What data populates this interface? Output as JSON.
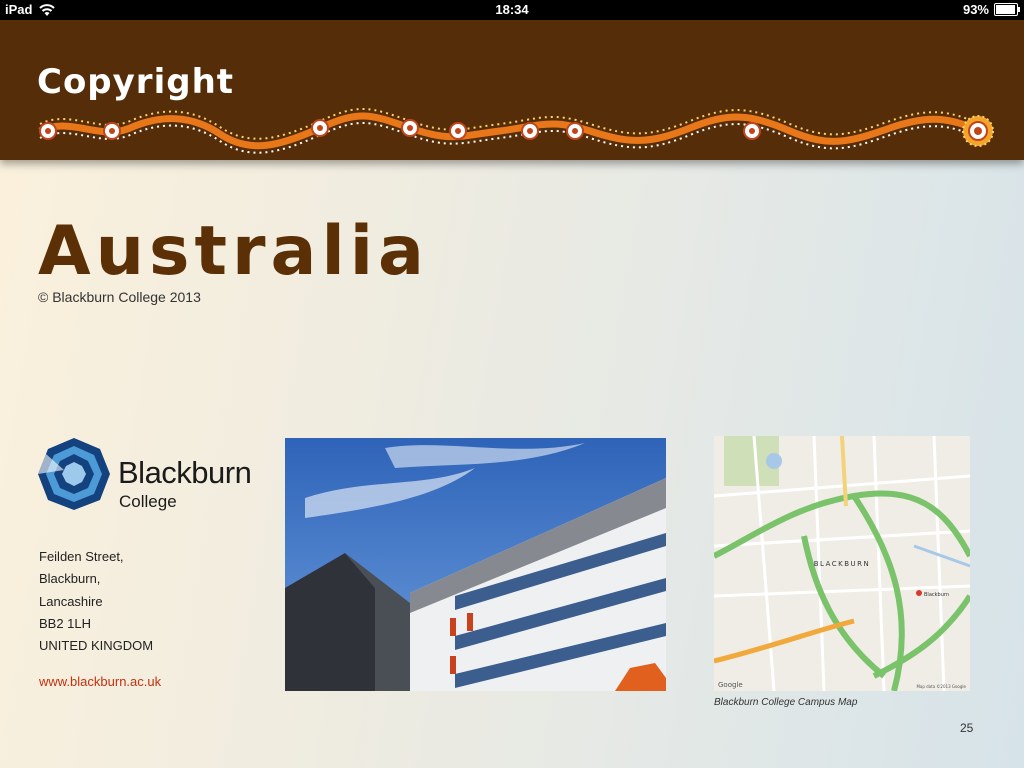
{
  "status_bar": {
    "device": "iPad",
    "time": "18:34",
    "battery": "93%",
    "battery_level": 0.93
  },
  "header": {
    "title": "Copyright"
  },
  "main": {
    "heading": "Australia",
    "copyright": "© Blackburn College 2013"
  },
  "logo": {
    "name": "Blackburn",
    "sub": "College"
  },
  "address": {
    "lines": [
      "Feilden Street,",
      "Blackburn,",
      "Lancashire",
      "BB2 1LH",
      "UNITED KINGDOM"
    ],
    "url": "www.blackburn.ac.uk"
  },
  "map": {
    "caption": "Blackburn College Campus Map",
    "place_label": "BLACKBURN",
    "poi_label": "Blackburn",
    "google": "Google",
    "attribution": "Map data ©2013 Google"
  },
  "page": {
    "number": "25"
  },
  "colors": {
    "header_bg": "#562d09",
    "heading": "#5b3007",
    "link": "#c4310f"
  }
}
